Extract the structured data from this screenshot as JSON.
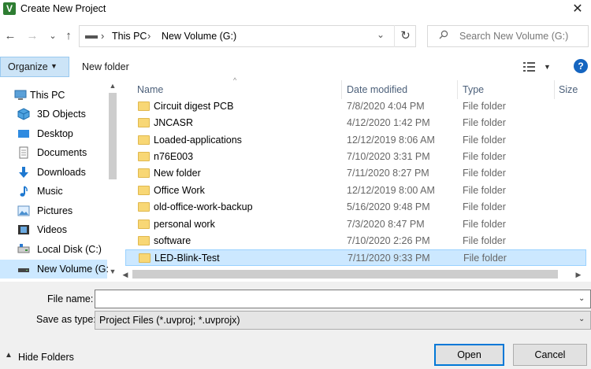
{
  "window": {
    "title": "Create New Project",
    "app_icon_letter": "V",
    "close_glyph": "✕"
  },
  "nav": {
    "back": "←",
    "forward": "→",
    "recent": "⌄",
    "up": "↑"
  },
  "address": {
    "crumbs": [
      "This PC",
      "New Volume (G:)"
    ],
    "separator": "›",
    "dropdown": "⌄",
    "refresh": "↻"
  },
  "search": {
    "placeholder": "Search New Volume (G:)",
    "icon": "search-icon"
  },
  "toolbar": {
    "organize_label": "Organize",
    "organize_caret": "▼",
    "new_folder_label": "New folder",
    "view_caret": "▼",
    "help_label": "?"
  },
  "sidebar": {
    "items": [
      {
        "label": "This PC",
        "icon": "pc-icon"
      },
      {
        "label": "3D Objects",
        "icon": "cube-icon"
      },
      {
        "label": "Desktop",
        "icon": "desktop-icon"
      },
      {
        "label": "Documents",
        "icon": "documents-icon"
      },
      {
        "label": "Downloads",
        "icon": "download-icon"
      },
      {
        "label": "Music",
        "icon": "music-icon"
      },
      {
        "label": "Pictures",
        "icon": "pictures-icon"
      },
      {
        "label": "Videos",
        "icon": "videos-icon"
      },
      {
        "label": "Local Disk (C:)",
        "icon": "drive-icon"
      },
      {
        "label": "New Volume (G:",
        "icon": "drive-icon"
      }
    ],
    "selected_index": 9
  },
  "list": {
    "columns": [
      "Name",
      "Date modified",
      "Type",
      "Size"
    ],
    "rows": [
      {
        "name": "Circuit digest PCB",
        "date": "7/8/2020 4:04 PM",
        "type": "File folder"
      },
      {
        "name": "JNCASR",
        "date": "4/12/2020 1:42 PM",
        "type": "File folder"
      },
      {
        "name": "Loaded-applications",
        "date": "12/12/2019 8:06 AM",
        "type": "File folder"
      },
      {
        "name": "n76E003",
        "date": "7/10/2020 3:31 PM",
        "type": "File folder"
      },
      {
        "name": "New folder",
        "date": "7/11/2020 8:27 PM",
        "type": "File folder"
      },
      {
        "name": "Office Work",
        "date": "12/12/2019 8:00 AM",
        "type": "File folder"
      },
      {
        "name": "old-office-work-backup",
        "date": "5/16/2020 9:48 PM",
        "type": "File folder"
      },
      {
        "name": "personal work",
        "date": "7/3/2020 8:47 PM",
        "type": "File folder"
      },
      {
        "name": "software",
        "date": "7/10/2020 2:26 PM",
        "type": "File folder"
      },
      {
        "name": "LED-Blink-Test",
        "date": "7/11/2020 9:33 PM",
        "type": "File folder"
      }
    ],
    "selected_index": 9
  },
  "form": {
    "file_name_label": "File name:",
    "file_name_value": "",
    "save_type_label": "Save as type:",
    "save_type_value": "Project Files (*.uvproj; *.uvprojx)",
    "dropdown_glyph": "⌄"
  },
  "footer": {
    "hide_folders_label": "Hide Folders",
    "hide_caret": "▲",
    "open_label": "Open",
    "cancel_label": "Cancel"
  },
  "colors": {
    "accent": "#0078d7",
    "selection": "#cce8ff",
    "folder": "#f8d775"
  }
}
